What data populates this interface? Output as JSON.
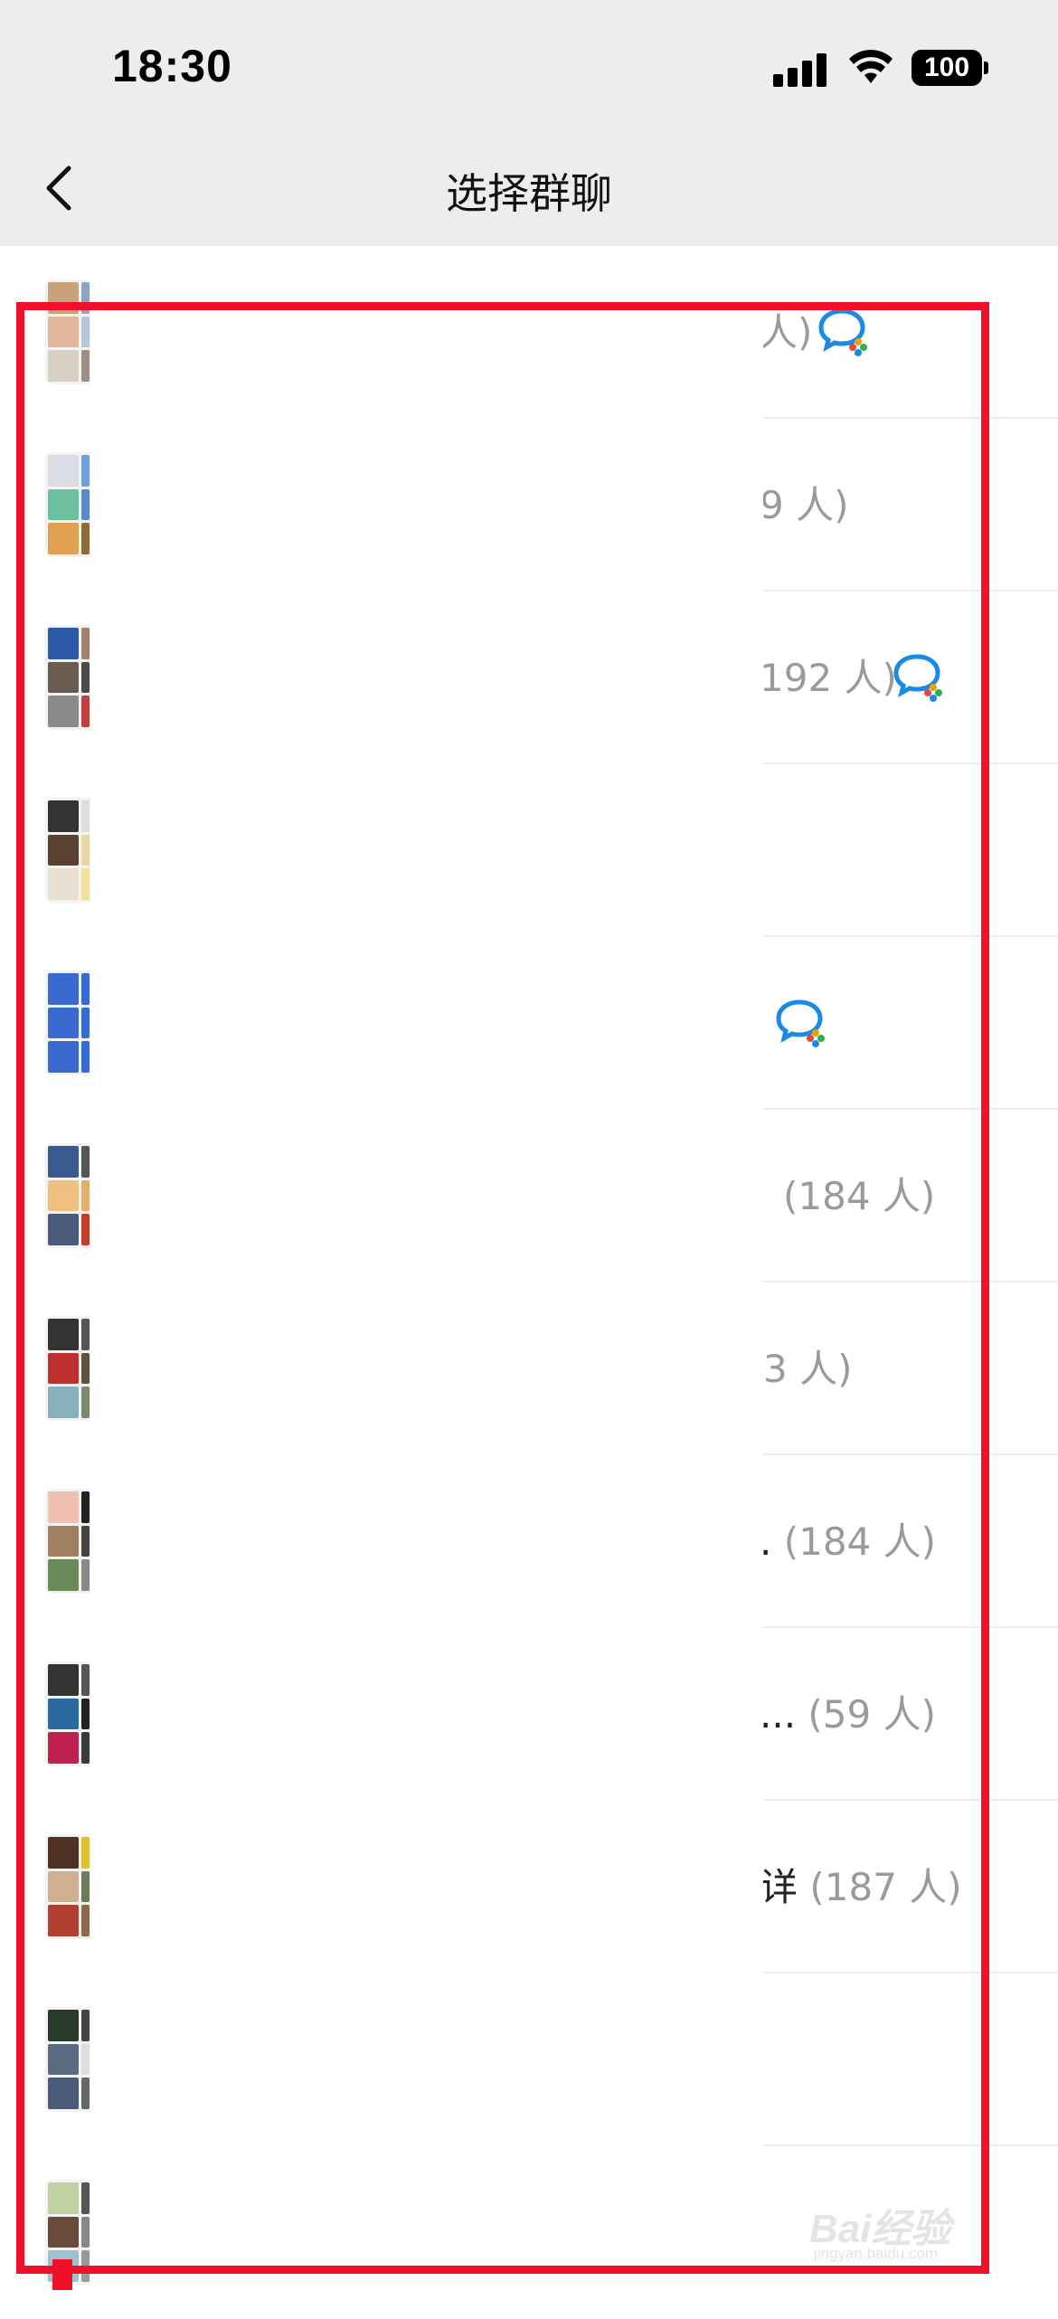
{
  "status_bar": {
    "time": "18:30",
    "battery": "100"
  },
  "nav": {
    "title": "选择群聊"
  },
  "rows": [
    {
      "text": "人)",
      "tail_dark": "",
      "has_wecom": true
    },
    {
      "text": "9 人)",
      "tail_dark": "",
      "has_wecom": false
    },
    {
      "text": "192 人)",
      "tail_dark": "",
      "has_wecom": true
    },
    {
      "text": "",
      "tail_dark": "",
      "has_wecom": false
    },
    {
      "text": "",
      "tail_dark": "",
      "has_wecom": true
    },
    {
      "text": "(184 人)",
      "tail_dark": "",
      "has_wecom": false
    },
    {
      "text": "3 人)",
      "tail_dark": "",
      "has_wecom": false
    },
    {
      "text": "(184 人)",
      "tail_dark": ".",
      "has_wecom": false
    },
    {
      "text": "(59 人)",
      "tail_dark": "...",
      "has_wecom": false
    },
    {
      "text": "(187 人)",
      "tail_dark": "详",
      "has_wecom": false
    },
    {
      "text": "",
      "tail_dark": "",
      "has_wecom": false
    },
    {
      "text": "",
      "tail_dark": "",
      "has_wecom": false
    }
  ],
  "watermark": {
    "text": "Bai经验",
    "sub": "jingyan.baidu.com"
  },
  "colors": {
    "highlight": "#f0102a",
    "header_bg": "#ededed",
    "count_text": "#9a9a9a"
  }
}
